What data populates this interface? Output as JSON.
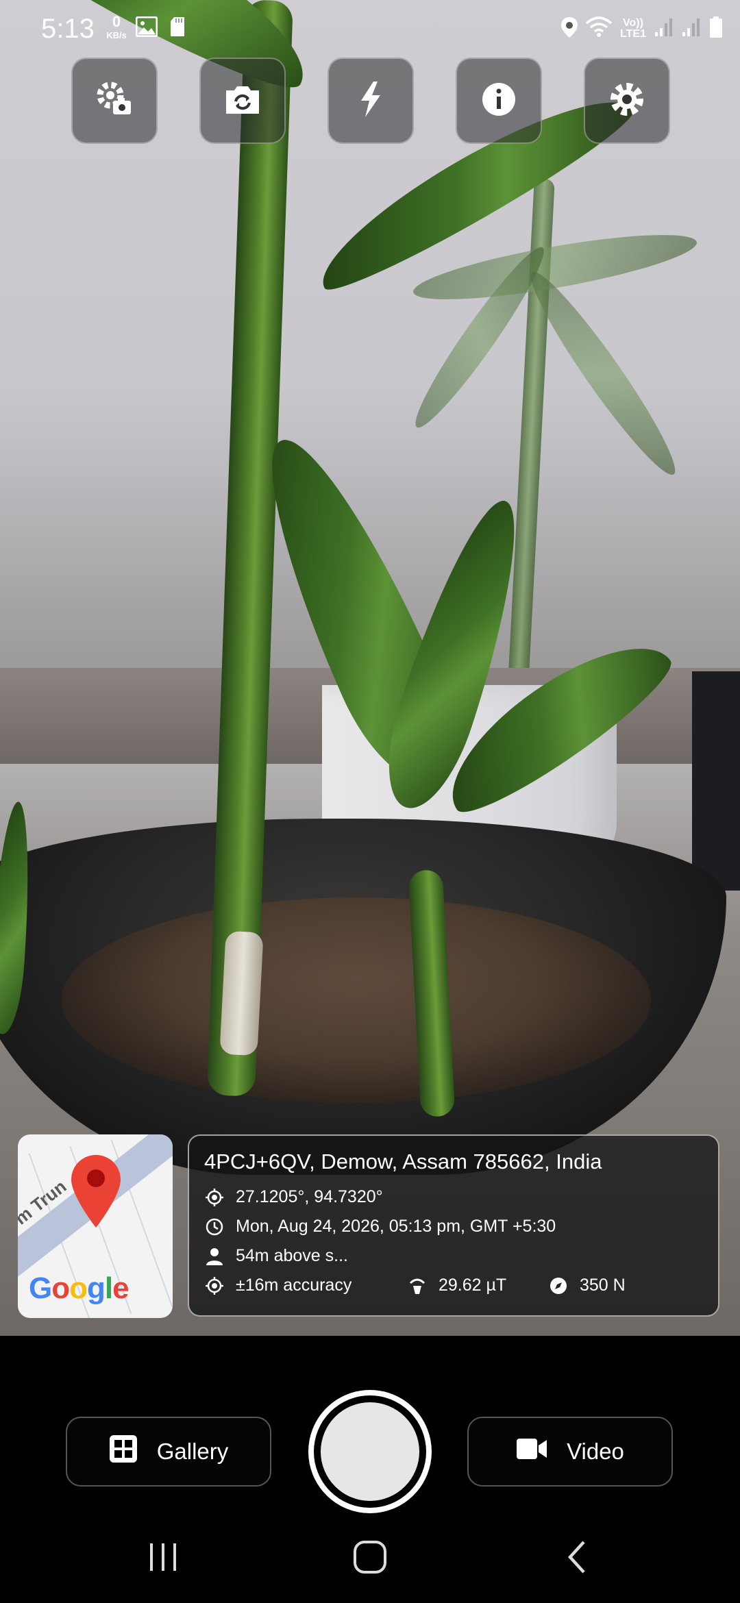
{
  "status_bar": {
    "time": "5:13",
    "net_speed_value": "0",
    "net_speed_unit": "KB/s",
    "network_label": "Vo)) LTE1"
  },
  "toolbar": {
    "camera_settings_icon": "camera-gear-icon",
    "switch_camera_icon": "camera-switch-icon",
    "flash_icon": "flash-icon",
    "info_icon": "info-icon",
    "settings_icon": "gear-icon"
  },
  "map": {
    "road_label": "m Trun",
    "logo_letters": [
      "G",
      "o",
      "o",
      "g",
      "l",
      "e"
    ]
  },
  "location_info": {
    "address": "4PCJ+6QV, Demow, Assam 785662, India",
    "coordinates": "27.1205°, 94.7320°",
    "datetime": "Mon, Aug 24, 2026, 05:13 pm, GMT +5:30",
    "altitude": "54m above s...",
    "accuracy": "±16m accuracy",
    "magnetic_field": "29.62 µT",
    "compass": "350 N"
  },
  "bottom_controls": {
    "gallery_label": "Gallery",
    "video_label": "Video"
  },
  "colors": {
    "accent_pin": "#EA4335",
    "panel_border": "#FFFFFF"
  }
}
